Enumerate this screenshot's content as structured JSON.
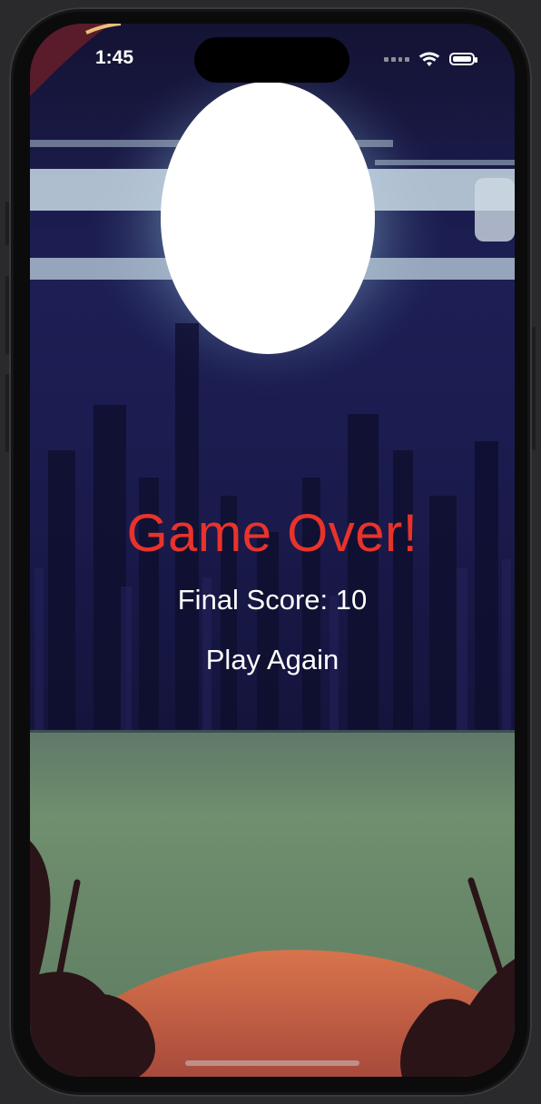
{
  "status_bar": {
    "time": "1:45",
    "icons": [
      "cellular-dots-icon",
      "wifi-icon",
      "battery-icon"
    ]
  },
  "game": {
    "title": "Game Over!",
    "score_text": "Final Score: 10",
    "play_again_label": "Play Again"
  },
  "colors": {
    "title_red": "#e8332b",
    "night_sky": "#14143a",
    "moon": "#ffffff",
    "grass": "#6e8c6c",
    "ground_orange": "#d8754f"
  }
}
